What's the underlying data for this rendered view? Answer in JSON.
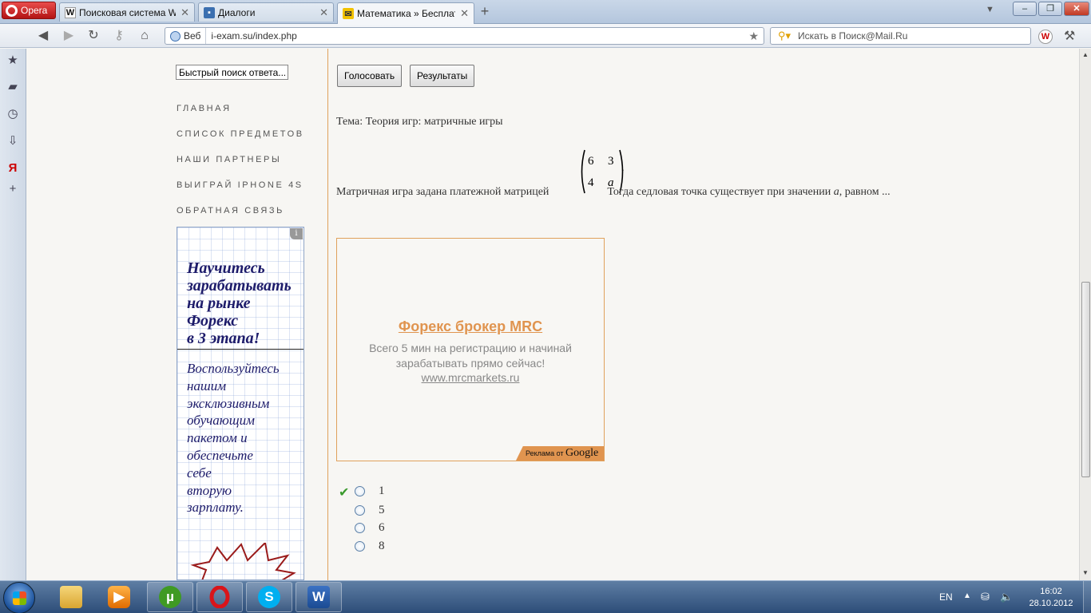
{
  "browser": {
    "menu_label": "Opera",
    "tabs": [
      {
        "label": "Поисковая система W...",
        "favicon": "W"
      },
      {
        "label": "Диалоги",
        "favicon": "chat-icon"
      },
      {
        "label": "Математика » Бесплат...",
        "favicon": "mail-icon"
      }
    ],
    "address": {
      "badge": "Веб",
      "url": "i-exam.su/index.php"
    },
    "search": {
      "placeholder": "Искать в Поиск@Mail.Ru"
    }
  },
  "sidebar": {
    "quick_search_value": "Быстрый поиск ответа...",
    "nav": [
      "ГЛАВНАЯ",
      "СПИСОК ПРЕДМЕТОВ",
      "НАШИ ПАРТНЕРЫ",
      "ВЫИГРАЙ IPHONE 4S",
      "ОБРАТНАЯ СВЯЗЬ"
    ],
    "ad": {
      "info": "i",
      "headline": [
        "Научитесь",
        "зарабатывать",
        "на рынке",
        "Форекс",
        "в 3 этапа!"
      ],
      "body": [
        "Воспользуйтесь",
        "нашим",
        "эксклюзивным",
        "обучающим",
        "пакетом и",
        "обеспечьте",
        "себе",
        "вторую",
        "зарплату."
      ]
    }
  },
  "poll": {
    "vote_label": "Голосовать",
    "results_label": "Результаты"
  },
  "question": {
    "topic": "Тема: Теория игр: матричные игры",
    "text_before": "Матричная игра задана платежной матрицей",
    "text_after": "Тогда седловая точка существует при значении",
    "variable": "a",
    "text_end": ", равном ...",
    "matrix": [
      [
        "6",
        "3"
      ],
      [
        "4",
        "a"
      ]
    ]
  },
  "google_ad": {
    "title": "Форекс брокер MRC",
    "text": "Всего 5 мин на регистрацию и начинай зарабатывать прямо сейчас!",
    "url": "www.mrcmarkets.ru",
    "badge_prefix": "Реклама от",
    "badge_brand": "Google"
  },
  "answers": [
    {
      "label": "1",
      "correct": true
    },
    {
      "label": "5",
      "correct": false
    },
    {
      "label": "6",
      "correct": false
    },
    {
      "label": "8",
      "correct": false
    }
  ],
  "taskbar": {
    "lang": "EN",
    "time": "16:02",
    "date": "28.10.2012"
  }
}
